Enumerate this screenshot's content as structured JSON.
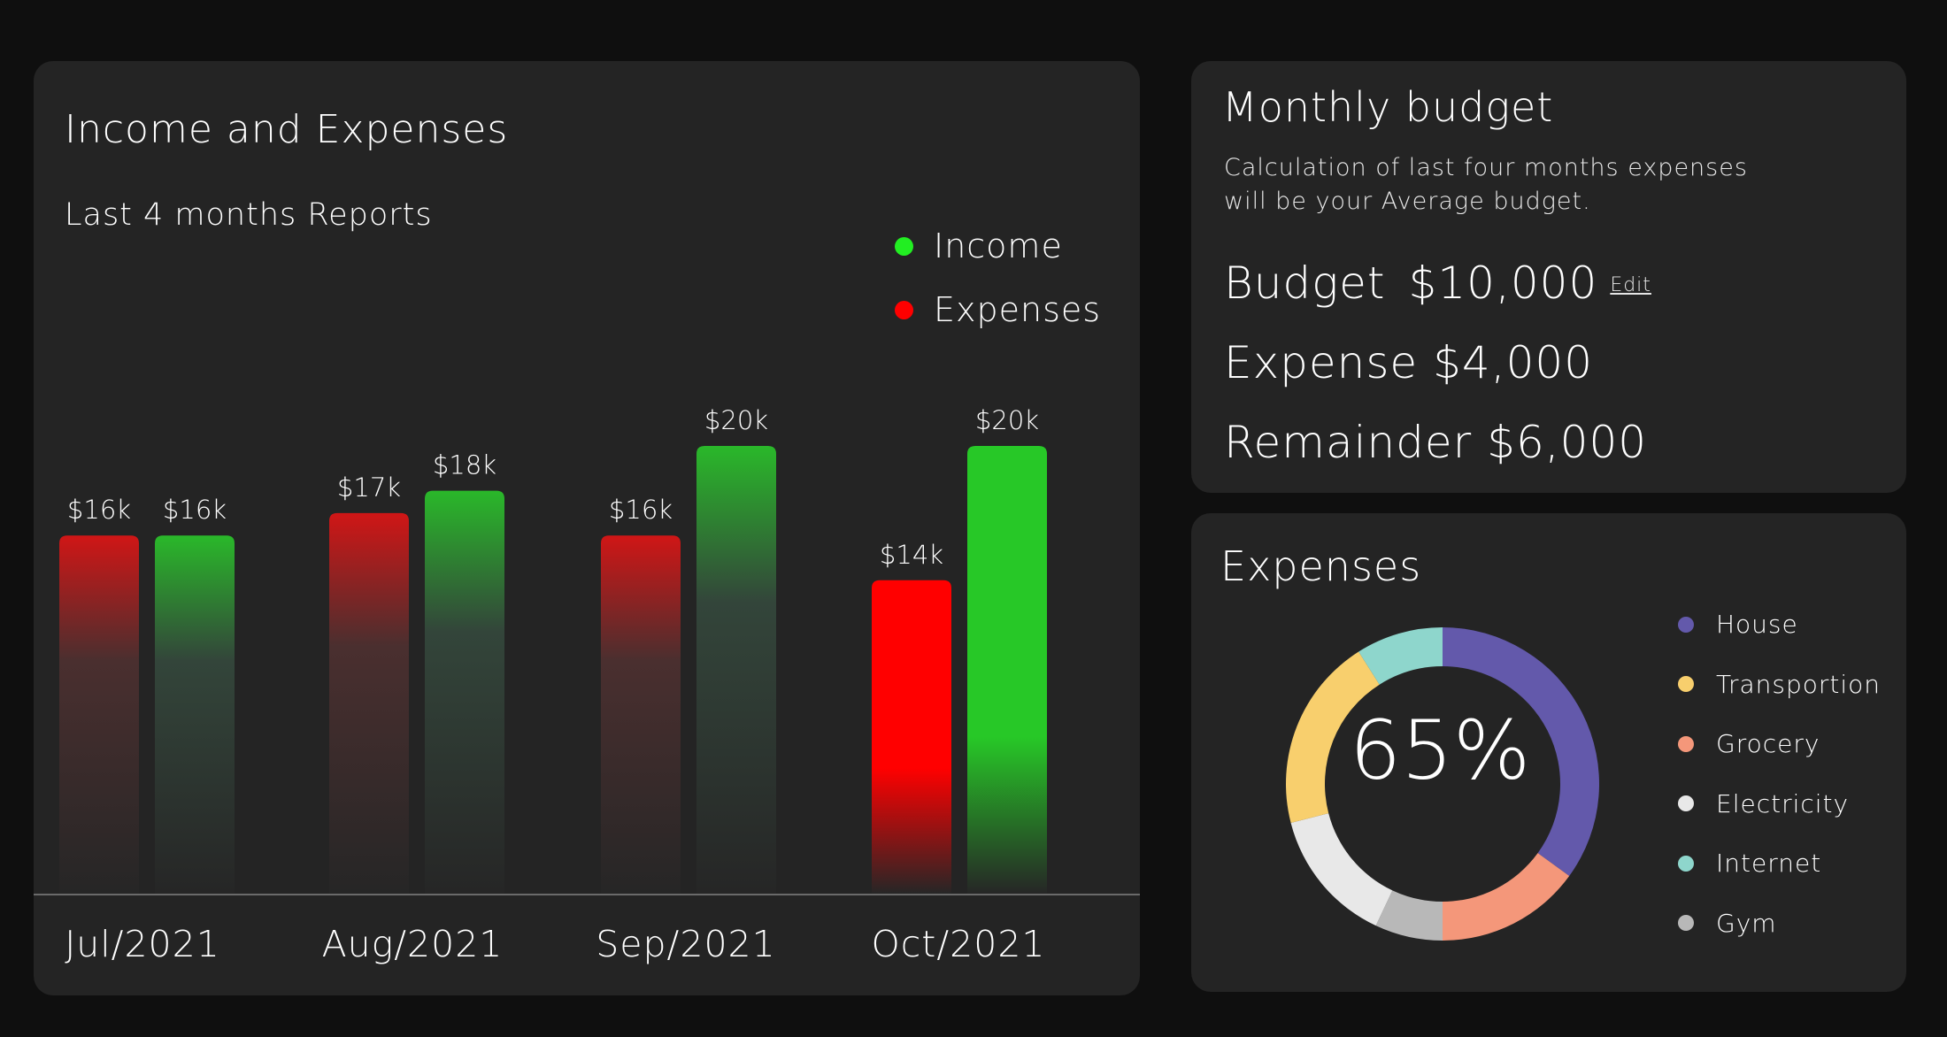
{
  "income_card": {
    "title": "Income and Expenses",
    "subtitle": "Last 4 months Reports",
    "legend": [
      {
        "label": "Income",
        "color": "#22ee22"
      },
      {
        "label": "Expenses",
        "color": "#ff0000"
      }
    ]
  },
  "budget_card": {
    "title": "Monthly budget",
    "description": "Calculation of last four months expenses will be your Average budget.",
    "budget_label": "Budget",
    "budget_value": "$10,000",
    "edit_label": "Edit",
    "expense_label": "Expense",
    "expense_value": "$4,000",
    "remainder_label": "Remainder",
    "remainder_value": "$6,000"
  },
  "expenses_card": {
    "title": "Expenses",
    "center_label": "65%"
  },
  "colors": {
    "income": "#2bc42b",
    "expenses": "#ff0000",
    "card_bg": "#242424",
    "page_bg": "#0f0f0f"
  },
  "chart_data": [
    {
      "type": "bar",
      "categories": [
        "Jul/2021",
        "Aug/2021",
        "Sep/2021",
        "Oct/2021"
      ],
      "series": [
        {
          "name": "Expenses",
          "values": [
            16,
            17,
            16,
            14
          ],
          "labels": [
            "$16k",
            "$17k",
            "$16k",
            "$14k"
          ],
          "color": "#ff0000"
        },
        {
          "name": "Income",
          "values": [
            16,
            18,
            20,
            20
          ],
          "labels": [
            "$16k",
            "$18k",
            "$20k",
            "$20k"
          ],
          "color": "#2bc42b"
        }
      ],
      "highlighted_category": "Oct/2021",
      "title": "Income and Expenses",
      "subtitle": "Last 4 months Reports",
      "legend_position": "top-right",
      "grid": false
    },
    {
      "type": "pie",
      "variant": "donut",
      "title": "Expenses",
      "center_label": "65%",
      "slices": [
        {
          "label": "House",
          "value": 35,
          "color": "#6359ab"
        },
        {
          "label": "Grocery",
          "value": 15,
          "color": "#f4977a"
        },
        {
          "label": "Gym",
          "value": 7,
          "color": "#b8b8b8"
        },
        {
          "label": "Electricity",
          "value": 14,
          "color": "#e8e8e8"
        },
        {
          "label": "Transportion",
          "value": 20,
          "color": "#f8cf6d"
        },
        {
          "label": "Internet",
          "value": 9,
          "color": "#8ed6cc"
        }
      ],
      "legend_order": [
        "House",
        "Transportion",
        "Grocery",
        "Electricity",
        "Internet",
        "Gym"
      ],
      "legend_position": "right"
    }
  ]
}
